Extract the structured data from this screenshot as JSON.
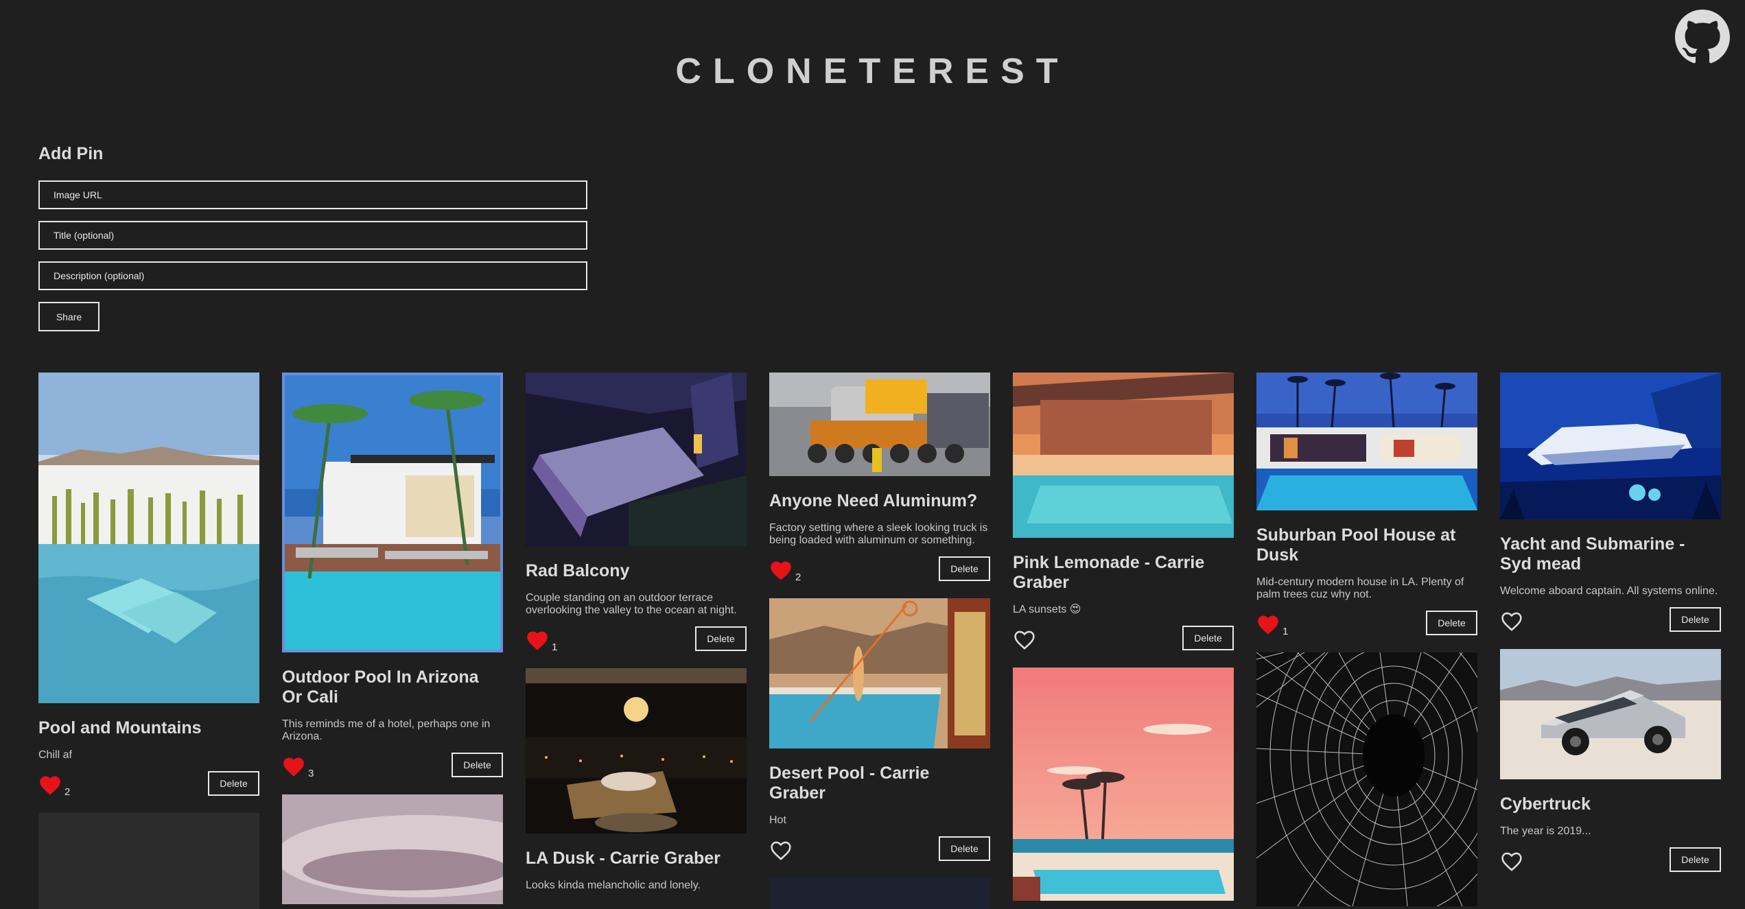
{
  "header": {
    "title": "CLONETEREST",
    "github_icon": "github-icon"
  },
  "add_pin": {
    "heading": "Add Pin",
    "image_url_placeholder": "Image URL",
    "title_placeholder": "Title (optional)",
    "description_placeholder": "Description (optional)",
    "share_label": "Share"
  },
  "labels": {
    "delete": "Delete"
  },
  "colors": {
    "background": "#1f1f1f",
    "heart_liked": "#e8121b",
    "text": "#dcdcdc"
  },
  "pins": {
    "c1p1": {
      "title": "Pool and Mountains",
      "description": "Chill af",
      "likes": "2",
      "liked": true
    },
    "c2p1": {
      "title": "Outdoor Pool In Arizona Or Cali",
      "description": "This reminds me of a hotel, perhaps one in Arizona.",
      "likes": "3",
      "liked": true
    },
    "c3p1": {
      "title": "Rad Balcony",
      "description": "Couple standing on an outdoor terrace overlooking the valley to the ocean at night.",
      "likes": "1",
      "liked": true
    },
    "c3p2": {
      "title": "LA Dusk - Carrie Graber",
      "description": "Looks kinda melancholic and lonely."
    },
    "c4p1": {
      "title": "Anyone Need Aluminum?",
      "description": "Factory setting where a sleek looking truck is being loaded with aluminum or something.",
      "likes": "2",
      "liked": true
    },
    "c4p2": {
      "title": "Desert Pool - Carrie Graber",
      "description": "Hot",
      "likes": "",
      "liked": false
    },
    "c5p1": {
      "title": "Pink Lemonade - Carrie Graber",
      "description": "LA sunsets 😍",
      "likes": "",
      "liked": false
    },
    "c6p1": {
      "title": "Suburban Pool House at Dusk",
      "description": "Mid-century modern house in LA. Plenty of palm trees cuz why not.",
      "likes": "1",
      "liked": true
    },
    "c7p1": {
      "title": "Yacht and Submarine - Syd mead",
      "description": "Welcome aboard captain. All systems online.",
      "likes": "",
      "liked": false
    },
    "c7p2": {
      "title": "Cybertruck",
      "description": "The year is 2019...",
      "likes": "",
      "liked": false
    }
  }
}
